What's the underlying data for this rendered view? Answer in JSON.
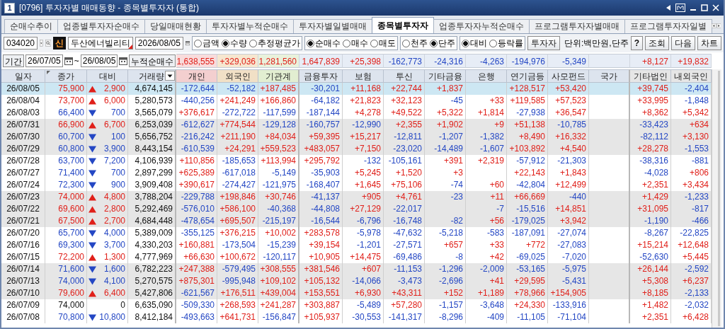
{
  "window": {
    "number": "1",
    "title": "[0796] 투자자별 매매동향 - 종목별투자자 (통합)"
  },
  "tabs": [
    {
      "label": "순매수추이",
      "selected": false
    },
    {
      "label": "업종별투자자순매수",
      "selected": false
    },
    {
      "label": "당일매매현황",
      "selected": false
    },
    {
      "label": "투자자별누적순매수",
      "selected": false
    },
    {
      "label": "투자자별일별매매",
      "selected": false
    },
    {
      "label": "종목별투자자",
      "selected": true
    },
    {
      "label": "업종투자자누적순매수",
      "selected": false
    },
    {
      "label": "프로그램투자자별매매",
      "selected": false
    },
    {
      "label": "프로그램투자자일별",
      "selected": false
    }
  ],
  "toolbar": {
    "stock_code": "034020",
    "credit_badge": "신",
    "stock_name": "두산에너빌리티",
    "date": "2026/08/05",
    "radio_groups": [
      {
        "options": [
          {
            "label": "금액",
            "selected": false
          },
          {
            "label": "수량",
            "selected": true
          },
          {
            "label": "추정평균가",
            "selected": false
          }
        ]
      },
      {
        "options": [
          {
            "label": "순매수",
            "selected": true
          },
          {
            "label": "매수",
            "selected": false
          },
          {
            "label": "매도",
            "selected": false
          }
        ]
      },
      {
        "options": [
          {
            "label": "천주",
            "selected": false
          },
          {
            "label": "단주",
            "selected": true
          }
        ]
      },
      {
        "options": [
          {
            "label": "대비",
            "selected": true
          },
          {
            "label": "등락률",
            "selected": false
          }
        ]
      }
    ],
    "investor_button": "투자자",
    "unit": "단위:백만원,단주",
    "buttons": [
      "?",
      "조회",
      "다음",
      "차트"
    ]
  },
  "period": {
    "label": "기간",
    "from": "26/07/05",
    "separator": "~",
    "to": "26/08/05",
    "cumulative_label": "누적순매수",
    "cumulative": {
      "individual": "1,638,555",
      "foreign": "+329,036",
      "institution": "1,281,560",
      "financial_investment": "1,647,839",
      "insurance": "+25,398",
      "investment_trust": "-162,773",
      "other_finance": "-24,316",
      "bank": "-4,263",
      "pension": "-194,976",
      "private_fund": "-5,349",
      "other_corporate": "+8,127",
      "domestic_foreign": "+19,832"
    }
  },
  "table": {
    "columns": [
      "일자",
      "종가",
      "대비",
      "거래량",
      "개인",
      "외국인",
      "기관계",
      "금융투자",
      "보험",
      "투신",
      "기타금융",
      "은행",
      "연기금등",
      "사모펀드",
      "국가",
      "기타법인",
      "내외국인"
    ],
    "rows": [
      {
        "date": "26/08/05",
        "close": "75,900",
        "kind": "up",
        "change": "2,900",
        "volume": "4,674,145",
        "values": {
          "individual": "-172,644",
          "foreign": "-52,182",
          "institution": "+187,485",
          "financial_investment": "-30,201",
          "insurance": "+11,168",
          "investment_trust": "+22,744",
          "other_finance": "+1,837",
          "pension": "+128,517",
          "private_fund": "+53,420",
          "other_corporate": "+39,745",
          "domestic_foreign": "-2,404"
        },
        "selected": true
      },
      {
        "date": "26/08/04",
        "close": "73,700",
        "kind": "up",
        "change": "6,000",
        "volume": "5,280,573",
        "values": {
          "individual": "-440,256",
          "foreign": "+241,249",
          "institution": "+166,860",
          "financial_investment": "-64,182",
          "insurance": "+21,823",
          "investment_trust": "+32,123",
          "other_finance": "-45",
          "bank": "+33",
          "pension": "+119,585",
          "private_fund": "+57,523",
          "other_corporate": "+33,995",
          "domestic_foreign": "-1,848"
        },
        "selected": false
      },
      {
        "date": "26/08/03",
        "close": "66,400",
        "kind": "down",
        "change": "700",
        "volume": "3,565,079",
        "values": {
          "individual": "+376,617",
          "foreign": "-272,722",
          "institution": "-117,599",
          "financial_investment": "-187,144",
          "insurance": "+4,278",
          "investment_trust": "+49,522",
          "other_finance": "+5,322",
          "bank": "+1,814",
          "pension": "-27,938",
          "private_fund": "+36,547",
          "other_corporate": "+8,362",
          "domestic_foreign": "+5,342"
        },
        "selected": false
      },
      {
        "date": "26/07/31",
        "close": "66,900",
        "kind": "up",
        "change": "6,700",
        "volume": "6,253,039",
        "values": {
          "individual": "-612,627",
          "foreign": "+774,544",
          "institution": "-129,128",
          "financial_investment": "-160,757",
          "insurance": "-12,990",
          "investment_trust": "+2,355",
          "other_finance": "+1,902",
          "bank": "+9",
          "pension": "+51,138",
          "private_fund": "-10,785",
          "other_corporate": "-33,423",
          "domestic_foreign": "+634"
        },
        "selected": false
      },
      {
        "date": "26/07/30",
        "close": "60,700",
        "kind": "down",
        "change": "100",
        "volume": "5,656,752",
        "values": {
          "individual": "-216,242",
          "foreign": "+211,190",
          "institution": "+84,034",
          "financial_investment": "+59,395",
          "insurance": "+15,217",
          "investment_trust": "-12,811",
          "other_finance": "-1,207",
          "bank": "-1,382",
          "pension": "+8,490",
          "private_fund": "+16,332",
          "other_corporate": "-82,112",
          "domestic_foreign": "+3,130"
        },
        "selected": false
      },
      {
        "date": "26/07/29",
        "close": "60,800",
        "kind": "down",
        "change": "3,900",
        "volume": "8,443,154",
        "values": {
          "individual": "-610,539",
          "foreign": "+24,291",
          "institution": "+559,523",
          "financial_investment": "+483,057",
          "insurance": "+7,150",
          "investment_trust": "-23,020",
          "other_finance": "-14,489",
          "bank": "-1,607",
          "pension": "+103,892",
          "private_fund": "+4,540",
          "other_corporate": "+28,278",
          "domestic_foreign": "-1,553"
        },
        "selected": false
      },
      {
        "date": "26/07/28",
        "close": "63,700",
        "kind": "down",
        "change": "7,200",
        "volume": "4,106,939",
        "values": {
          "individual": "+110,856",
          "foreign": "-185,653",
          "institution": "+113,994",
          "financial_investment": "+295,792",
          "insurance": "-132",
          "investment_trust": "-105,161",
          "other_finance": "+391",
          "bank": "+2,319",
          "pension": "-57,912",
          "private_fund": "-21,303",
          "other_corporate": "-38,316",
          "domestic_foreign": "-881"
        },
        "selected": false
      },
      {
        "date": "26/07/27",
        "close": "71,400",
        "kind": "down",
        "change": "700",
        "volume": "2,897,299",
        "values": {
          "individual": "+625,389",
          "foreign": "-617,018",
          "institution": "-5,149",
          "financial_investment": "-35,903",
          "insurance": "+5,245",
          "investment_trust": "+1,520",
          "other_finance": "+3",
          "pension": "+22,143",
          "private_fund": "+1,843",
          "other_corporate": "-4,028",
          "domestic_foreign": "+806"
        },
        "selected": false
      },
      {
        "date": "26/07/24",
        "close": "72,300",
        "kind": "down",
        "change": "900",
        "volume": "3,909,408",
        "values": {
          "individual": "+390,617",
          "foreign": "-274,427",
          "institution": "-121,975",
          "financial_investment": "-168,407",
          "insurance": "+1,645",
          "investment_trust": "+75,106",
          "other_finance": "-74",
          "bank": "+60",
          "pension": "-42,804",
          "private_fund": "+12,499",
          "other_corporate": "+2,351",
          "domestic_foreign": "+3,434"
        },
        "selected": false
      },
      {
        "date": "26/07/23",
        "close": "74,000",
        "kind": "up",
        "change": "4,800",
        "volume": "3,788,204",
        "values": {
          "individual": "-229,788",
          "foreign": "+198,846",
          "institution": "+30,746",
          "financial_investment": "-41,137",
          "insurance": "+905",
          "investment_trust": "+4,761",
          "other_finance": "-23",
          "bank": "+11",
          "pension": "+66,669",
          "private_fund": "-440",
          "other_corporate": "+1,429",
          "domestic_foreign": "-1,233"
        },
        "selected": false
      },
      {
        "date": "26/07/22",
        "close": "69,600",
        "kind": "up",
        "change": "2,800",
        "volume": "5,292,469",
        "values": {
          "individual": "-576,010",
          "foreign": "+586,100",
          "institution": "-40,368",
          "financial_investment": "-44,808",
          "insurance": "+27,129",
          "investment_trust": "-22,017",
          "bank": "-7",
          "pension": "-15,516",
          "private_fund": "+14,851",
          "other_corporate": "+31,095",
          "domestic_foreign": "-817"
        },
        "selected": false
      },
      {
        "date": "26/07/21",
        "close": "67,500",
        "kind": "up",
        "change": "2,700",
        "volume": "4,684,448",
        "values": {
          "individual": "-478,654",
          "foreign": "+695,507",
          "institution": "-215,197",
          "financial_investment": "-16,544",
          "insurance": "-6,796",
          "investment_trust": "-16,748",
          "other_finance": "-82",
          "bank": "+56",
          "pension": "-179,025",
          "private_fund": "+3,942",
          "other_corporate": "-1,190",
          "domestic_foreign": "-466"
        },
        "selected": false
      },
      {
        "date": "26/07/20",
        "close": "65,700",
        "kind": "down",
        "change": "4,000",
        "volume": "5,389,009",
        "values": {
          "individual": "-355,125",
          "foreign": "+376,215",
          "institution": "+10,002",
          "financial_investment": "+283,578",
          "insurance": "-5,978",
          "investment_trust": "-47,632",
          "other_finance": "-5,218",
          "bank": "-583",
          "pension": "-187,091",
          "private_fund": "-27,074",
          "other_corporate": "-8,267",
          "domestic_foreign": "-22,825"
        },
        "selected": false
      },
      {
        "date": "26/07/16",
        "close": "69,300",
        "kind": "down",
        "change": "3,700",
        "volume": "4,330,203",
        "values": {
          "individual": "+160,881",
          "foreign": "-173,504",
          "institution": "-15,239",
          "financial_investment": "+39,154",
          "insurance": "-1,201",
          "investment_trust": "-27,571",
          "other_finance": "+657",
          "bank": "+33",
          "pension": "+772",
          "private_fund": "-27,083",
          "other_corporate": "+15,214",
          "domestic_foreign": "+12,648"
        },
        "selected": false
      },
      {
        "date": "26/07/15",
        "close": "72,200",
        "kind": "up",
        "change": "1,300",
        "volume": "4,777,969",
        "values": {
          "individual": "+66,630",
          "foreign": "+100,672",
          "institution": "-120,117",
          "financial_investment": "+10,905",
          "insurance": "+14,475",
          "investment_trust": "-69,486",
          "other_finance": "-8",
          "bank": "+42",
          "pension": "-69,025",
          "private_fund": "-7,020",
          "other_corporate": "-52,630",
          "domestic_foreign": "+5,445"
        },
        "selected": false
      },
      {
        "date": "26/07/14",
        "close": "71,600",
        "kind": "down",
        "change": "1,600",
        "volume": "6,782,223",
        "values": {
          "individual": "+247,388",
          "foreign": "-579,495",
          "institution": "+308,555",
          "financial_investment": "+381,546",
          "insurance": "+607",
          "investment_trust": "-11,153",
          "other_finance": "-1,296",
          "bank": "-2,009",
          "pension": "-53,165",
          "private_fund": "-5,975",
          "other_corporate": "+26,144",
          "domestic_foreign": "-2,592"
        },
        "selected": false
      },
      {
        "date": "26/07/13",
        "close": "74,000",
        "kind": "down",
        "change": "4,100",
        "volume": "5,270,575",
        "values": {
          "individual": "+875,301",
          "foreign": "-995,948",
          "institution": "+109,102",
          "financial_investment": "+105,132",
          "insurance": "-14,066",
          "investment_trust": "-3,473",
          "other_finance": "-2,696",
          "bank": "+41",
          "pension": "+29,595",
          "private_fund": "-5,431",
          "other_corporate": "+5,308",
          "domestic_foreign": "+6,237"
        },
        "selected": false
      },
      {
        "date": "26/07/10",
        "close": "79,600",
        "kind": "up",
        "change": "6,400",
        "volume": "5,427,806",
        "values": {
          "individual": "-621,567",
          "foreign": "+176,511",
          "institution": "+439,004",
          "financial_investment": "+153,551",
          "insurance": "+6,930",
          "investment_trust": "+43,311",
          "other_finance": "+152",
          "bank": "+1,189",
          "pension": "+78,966",
          "private_fund": "+154,905",
          "other_corporate": "+8,185",
          "domestic_foreign": "-2,133"
        },
        "selected": false
      },
      {
        "date": "26/07/09",
        "close": "74,000",
        "kind": "flat",
        "change": "0",
        "volume": "6,635,090",
        "values": {
          "individual": "-509,330",
          "foreign": "+268,593",
          "institution": "+241,287",
          "financial_investment": "+303,887",
          "insurance": "-5,489",
          "investment_trust": "+57,280",
          "other_finance": "-1,157",
          "bank": "-3,648",
          "pension": "+24,330",
          "private_fund": "-133,916",
          "other_corporate": "+1,482",
          "domestic_foreign": "-2,032"
        },
        "selected": false
      },
      {
        "date": "26/07/08",
        "close": "70,800",
        "kind": "down",
        "change": "10,800",
        "volume": "8,412,184",
        "values": {
          "individual": "-493,663",
          "foreign": "+641,731",
          "institution": "-156,847",
          "financial_investment": "+105,937",
          "insurance": "-30,553",
          "investment_trust": "-141,317",
          "other_finance": "-8,296",
          "bank": "-409",
          "pension": "-11,105",
          "private_fund": "-71,104",
          "other_corporate": "+2,351",
          "domestic_foreign": "+6,428"
        },
        "selected": false
      }
    ]
  }
}
